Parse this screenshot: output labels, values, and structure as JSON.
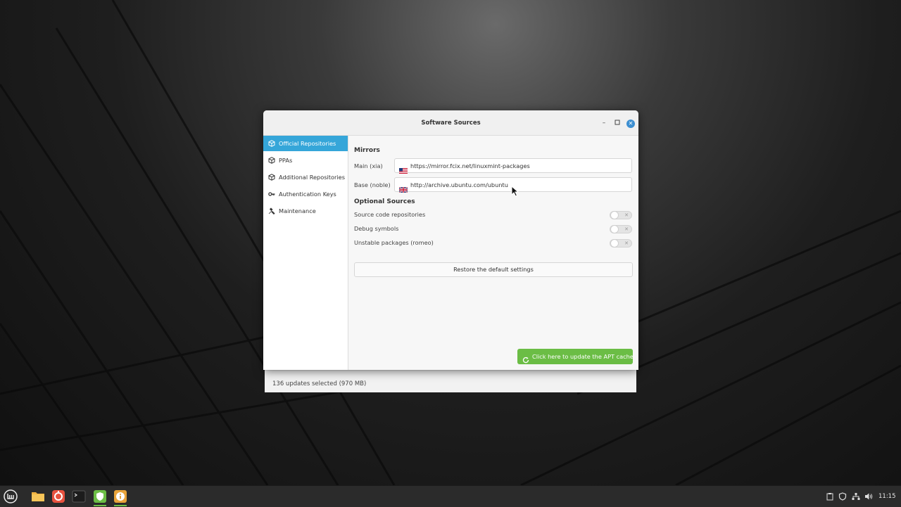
{
  "dialog": {
    "title": "Software Sources",
    "sidebar": {
      "items": [
        {
          "label": "Official Repositories",
          "active": true
        },
        {
          "label": "PPAs",
          "active": false
        },
        {
          "label": "Additional Repositories",
          "active": false
        },
        {
          "label": "Authentication Keys",
          "active": false
        },
        {
          "label": "Maintenance",
          "active": false
        }
      ]
    },
    "mirrors": {
      "heading": "Mirrors",
      "main_label": "Main (xia)",
      "main_url": "https://mirror.fcix.net/linuxmint-packages",
      "base_label": "Base (noble)",
      "base_url": "http://archive.ubuntu.com/ubuntu"
    },
    "optional": {
      "heading": "Optional Sources",
      "items": [
        {
          "label": "Source code repositories",
          "enabled": false
        },
        {
          "label": "Debug symbols",
          "enabled": false
        },
        {
          "label": "Unstable packages (romeo)",
          "enabled": false
        }
      ]
    },
    "restore_label": "Restore the default settings",
    "apt_label": "Click here to update the APT cache"
  },
  "update_manager": {
    "status": "136 updates selected (970 MB)"
  },
  "panel": {
    "clock": "11:15"
  }
}
